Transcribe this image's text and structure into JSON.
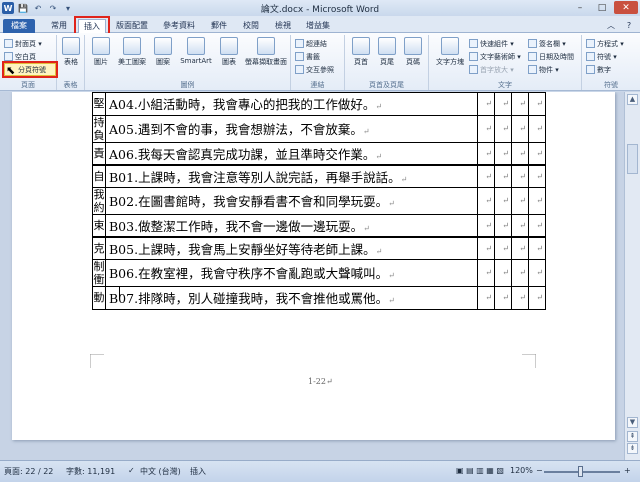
{
  "window": {
    "title": "論文.docx - Microsoft Word",
    "minimize": "–",
    "maximize": "□",
    "close": "✕"
  },
  "quick_access": {
    "word_icon": "W",
    "save_icon": "💾",
    "undo_icon": "↶",
    "redo_icon": "↷",
    "customize_icon": "▾"
  },
  "menu": {
    "tabs": [
      "檔案",
      "常用",
      "插入",
      "版面配置",
      "參考資料",
      "郵件",
      "校閱",
      "檢視",
      "增益集"
    ],
    "active": "插入",
    "right_icons": [
      "︿",
      "?"
    ]
  },
  "ribbon": {
    "groups": [
      "頁面",
      "表格",
      "圖例",
      "連結",
      "頁首及頁尾",
      "文字",
      "符號"
    ],
    "pages": {
      "cover_page": "封面頁 ▾",
      "blank_page": "空白頁",
      "page_break": "分頁符號"
    },
    "table": {
      "table_btn": "表格"
    },
    "illustrations": {
      "picture": "圖片",
      "clip_art": "美工圖案",
      "shapes": "圖案",
      "smartart": "SmartArt",
      "chart": "圖表",
      "screenshot": "螢幕擷取畫面"
    },
    "links": {
      "hyperlink": "超連結",
      "bookmark": "書籤",
      "cross_ref": "交互參照"
    },
    "header_footer": {
      "header": "頁首",
      "footer": "頁尾",
      "page_number": "頁碼"
    },
    "text": {
      "textbox": "文字方塊",
      "quick_parts": "快速組件 ▾",
      "wordart": "文字藝術師 ▾",
      "drop_cap": "首字放大 ▾",
      "signature": "簽名欄 ▾",
      "datetime": "日期及時間",
      "object": "物件 ▾"
    },
    "symbols": {
      "equation": "方程式 ▾",
      "symbol": "符號 ▾",
      "number": "數字"
    }
  },
  "table": {
    "rows": [
      {
        "cat": "堅",
        "text": "A04.小組活動時，我會專心的把我的工作做好。"
      },
      {
        "cat": "持負",
        "text": "A05.遇到不會的事，我會想辦法，不會放棄。"
      },
      {
        "cat": "責",
        "text": "A06.我每天會認真完成功課，並且準時交作業。"
      },
      {
        "cat": "自",
        "text": "B01.上課時，我會注意等別人說完話，再舉手說話。"
      },
      {
        "cat": "我約",
        "text": "B02.在圖書館時，我會安靜看書不會和同學玩耍。"
      },
      {
        "cat": "束",
        "text": "B03.做整潔工作時，我不會一邊做一邊玩耍。"
      },
      {
        "cat": "克",
        "text": "B05.上課時，我會馬上安靜坐好等待老師上課。"
      },
      {
        "cat": "制衝",
        "text": "B06.在教室裡，我會守秩序不會亂跑或大聲喊叫。"
      },
      {
        "cat": "動",
        "text": "B07.排隊時，別人碰撞我時，我不會推他或罵他。"
      }
    ],
    "cell_mark": "↵"
  },
  "page": {
    "number": "1-22↵"
  },
  "status": {
    "page": "頁面: 22 / 22",
    "words": "字數: 11,191",
    "lang": "中文 (台灣)",
    "mode": "插入",
    "zoom": "120%",
    "zoom_minus": "−",
    "zoom_plus": "+",
    "zoom_level": 0.45
  }
}
